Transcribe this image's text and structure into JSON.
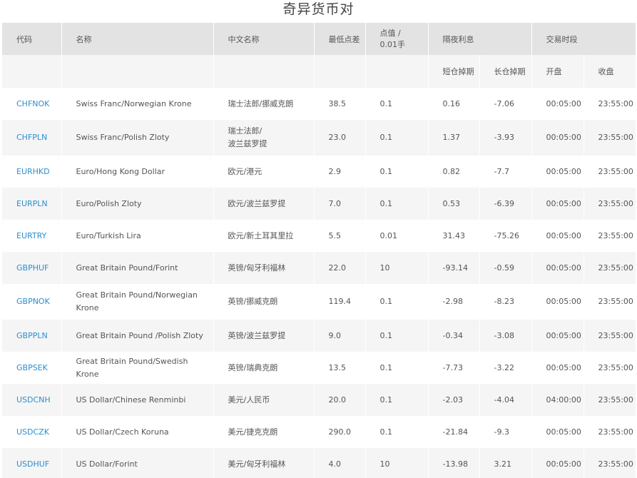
{
  "page": {
    "title": "奇异货币对"
  },
  "headers": {
    "code": "代码",
    "name": "名称",
    "cn_name": "中文名称",
    "min_spread": "最低点差",
    "pip_value_line1": "点值 /",
    "pip_value_line2": "0.01手",
    "swap": "隔夜利息",
    "trading_hours": "交易时段",
    "swap_short": "短仓掉期",
    "swap_long": "长仓掉期",
    "open": "开盘",
    "close": "收盘"
  },
  "rows": [
    {
      "code": "CHFNOK",
      "name": "Swiss Franc/Norwegian Krone",
      "cn": "瑞士法郎/挪威克朗",
      "spread": "38.5",
      "pip": "0.1",
      "short": "0.16",
      "long": "-7.06",
      "open": "00:05:00",
      "close": "23:55:00"
    },
    {
      "code": "CHFPLN",
      "name": "Swiss Franc/Polish Zloty",
      "cn": "瑞士法郎/\n波兰兹罗提",
      "spread": "23.0",
      "pip": "0.1",
      "short": "1.37",
      "long": "-3.93",
      "open": "00:05:00",
      "close": "23:55:00"
    },
    {
      "code": "EURHKD",
      "name": "Euro/Hong Kong Dollar",
      "cn": "欧元/港元",
      "spread": "2.9",
      "pip": "0.1",
      "short": "0.82",
      "long": "-7.7",
      "open": "00:05:00",
      "close": "23:55:00"
    },
    {
      "code": "EURPLN",
      "name": "Euro/Polish Zloty",
      "cn": "欧元/波兰兹罗提",
      "spread": "7.0",
      "pip": "0.1",
      "short": "0.53",
      "long": "-6.39",
      "open": "00:05:00",
      "close": "23:55:00"
    },
    {
      "code": "EURTRY",
      "name": "Euro/Turkish Lira",
      "cn": "欧元/新土耳其里拉",
      "spread": "5.5",
      "pip": "0.01",
      "short": "31.43",
      "long": "-75.26",
      "open": "00:05:00",
      "close": "23:55:00"
    },
    {
      "code": "GBPHUF",
      "name": "Great Britain Pound/Forint",
      "cn": "英镑/匈牙利福林",
      "spread": "22.0",
      "pip": "10",
      "short": "-93.14",
      "long": "-0.59",
      "open": "00:05:00",
      "close": "23:55:00"
    },
    {
      "code": "GBPNOK",
      "name": "Great Britain Pound/Norwegian Krone",
      "cn": "英镑/挪威克朗",
      "spread": "119.4",
      "pip": "0.1",
      "short": "-2.98",
      "long": "-8.23",
      "open": "00:05:00",
      "close": "23:55:00"
    },
    {
      "code": "GBPPLN",
      "name": "Great Britain Pound /Polish Zloty",
      "cn": "英镑/波兰兹罗提",
      "spread": "9.0",
      "pip": "0.1",
      "short": "-0.34",
      "long": "-3.08",
      "open": "00:05:00",
      "close": "23:55:00"
    },
    {
      "code": "GBPSEK",
      "name": "Great Britain Pound/Swedish Krone",
      "cn": "英镑/瑞典克朗",
      "spread": "13.5",
      "pip": "0.1",
      "short": "-7.73",
      "long": "-3.22",
      "open": "00:05:00",
      "close": "23:55:00"
    },
    {
      "code": "USDCNH",
      "name": "US Dollar/Chinese Renminbi",
      "cn": "美元/人民币",
      "spread": "20.0",
      "pip": "0.1",
      "short": "-2.03",
      "long": "-4.04",
      "open": "04:00:00",
      "close": "23:55:00"
    },
    {
      "code": "USDCZK",
      "name": "US Dollar/Czech Koruna",
      "cn": "美元/捷克克朗",
      "spread": "290.0",
      "pip": "0.1",
      "short": "-21.84",
      "long": "-9.3",
      "open": "00:05:00",
      "close": "23:55:00"
    },
    {
      "code": "USDHUF",
      "name": "US Dollar/Forint",
      "cn": "美元/匈牙利福林",
      "spread": "4.0",
      "pip": "10",
      "short": "-13.98",
      "long": "3.21",
      "open": "00:05:00",
      "close": "23:55:00"
    }
  ]
}
